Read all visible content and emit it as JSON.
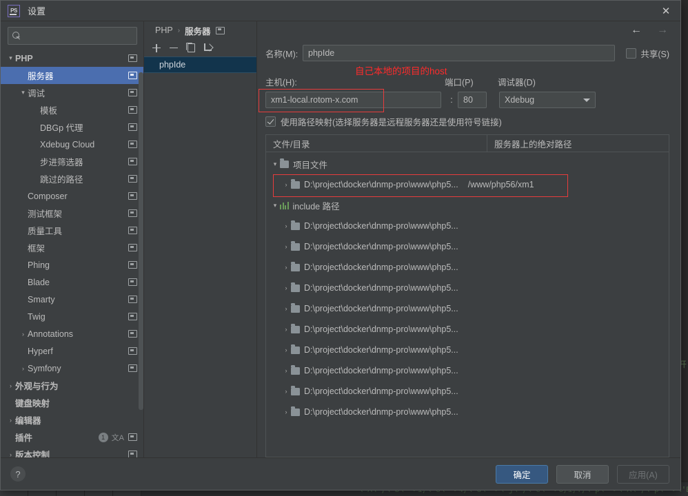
{
  "window": {
    "title": "设置",
    "app_badge": "PS",
    "close_icon": "✕"
  },
  "search": {
    "value": "",
    "placeholder": ""
  },
  "sidebar": {
    "items": [
      {
        "label": "PHP",
        "indent": 0,
        "twisty": "▾",
        "bold": true,
        "selected": false,
        "copy": true
      },
      {
        "label": "服务器",
        "indent": 1,
        "twisty": "",
        "bold": false,
        "selected": true,
        "copy": true
      },
      {
        "label": "调试",
        "indent": 1,
        "twisty": "▾",
        "bold": false,
        "selected": false,
        "copy": true
      },
      {
        "label": "模板",
        "indent": 2,
        "twisty": "",
        "bold": false,
        "selected": false,
        "copy": true
      },
      {
        "label": "DBGp 代理",
        "indent": 2,
        "twisty": "",
        "bold": false,
        "selected": false,
        "copy": true
      },
      {
        "label": "Xdebug Cloud",
        "indent": 2,
        "twisty": "",
        "bold": false,
        "selected": false,
        "copy": true
      },
      {
        "label": "步进筛选器",
        "indent": 2,
        "twisty": "",
        "bold": false,
        "selected": false,
        "copy": true
      },
      {
        "label": "跳过的路径",
        "indent": 2,
        "twisty": "",
        "bold": false,
        "selected": false,
        "copy": true
      },
      {
        "label": "Composer",
        "indent": 1,
        "twisty": "",
        "bold": false,
        "selected": false,
        "copy": true
      },
      {
        "label": "测试框架",
        "indent": 1,
        "twisty": "",
        "bold": false,
        "selected": false,
        "copy": true
      },
      {
        "label": "质量工具",
        "indent": 1,
        "twisty": "",
        "bold": false,
        "selected": false,
        "copy": true
      },
      {
        "label": "框架",
        "indent": 1,
        "twisty": "",
        "bold": false,
        "selected": false,
        "copy": true
      },
      {
        "label": "Phing",
        "indent": 1,
        "twisty": "",
        "bold": false,
        "selected": false,
        "copy": true
      },
      {
        "label": "Blade",
        "indent": 1,
        "twisty": "",
        "bold": false,
        "selected": false,
        "copy": true
      },
      {
        "label": "Smarty",
        "indent": 1,
        "twisty": "",
        "bold": false,
        "selected": false,
        "copy": true
      },
      {
        "label": "Twig",
        "indent": 1,
        "twisty": "",
        "bold": false,
        "selected": false,
        "copy": true
      },
      {
        "label": "Annotations",
        "indent": 1,
        "twisty": "›",
        "bold": false,
        "selected": false,
        "copy": true
      },
      {
        "label": "Hyperf",
        "indent": 1,
        "twisty": "",
        "bold": false,
        "selected": false,
        "copy": true
      },
      {
        "label": "Symfony",
        "indent": 1,
        "twisty": "›",
        "bold": false,
        "selected": false,
        "copy": true
      },
      {
        "label": "外观与行为",
        "indent": 0,
        "twisty": "›",
        "bold": true,
        "selected": false,
        "copy": false
      },
      {
        "label": "键盘映射",
        "indent": 0,
        "twisty": "",
        "bold": true,
        "selected": false,
        "copy": false
      },
      {
        "label": "编辑器",
        "indent": 0,
        "twisty": "›",
        "bold": true,
        "selected": false,
        "copy": false
      },
      {
        "label": "插件",
        "indent": 0,
        "twisty": "",
        "bold": true,
        "selected": false,
        "copy": true,
        "badge": "1",
        "translate": "文A"
      },
      {
        "label": "版本控制",
        "indent": 0,
        "twisty": "›",
        "bold": true,
        "selected": false,
        "copy": true
      }
    ]
  },
  "breadcrumb": {
    "root": "PHP",
    "separator": "›",
    "current": "服务器"
  },
  "list_toolbar": {
    "add": "add-icon",
    "remove": "remove-icon",
    "copy": "copy-icon",
    "import": "import-icon"
  },
  "server_list": {
    "items": [
      {
        "name": "phpIde",
        "selected": true
      }
    ]
  },
  "nav": {
    "back": "←",
    "forward": "→"
  },
  "form": {
    "name_label": "名称(M):",
    "name_mnemonic": "M",
    "name_value": "phpIde",
    "share_label": "共享(S)",
    "share_checked": false,
    "host_label": "主机(H):",
    "host_value": "xm1-local.rotom-x.com",
    "colon": ":",
    "port_label": "端口(P)",
    "port_value": "80",
    "debugger_label": "调试器(D)",
    "debugger_value": "Xdebug",
    "usemap_label": "使用路径映射(选择服务器是远程服务器还是使用符号链接)",
    "usemap_checked": true,
    "annotation": "自己本地的项目的host",
    "annotation_color": "#ff2b2b"
  },
  "mapping_table": {
    "col1": "文件/目录",
    "col2": "服务器上的绝对路径",
    "groups": [
      {
        "twisty": "▾",
        "icon": "folder-icon",
        "label": "项目文件",
        "rows": [
          {
            "twisty": "›",
            "icon": "folder-icon",
            "local": "D:\\project\\docker\\dnmp-pro\\www\\php5...",
            "remote": "/www/php56/xm1",
            "highlighted": true
          }
        ]
      },
      {
        "twisty": "▾",
        "icon": "include-bars-icon",
        "label": "include 路径",
        "rows": [
          {
            "twisty": "›",
            "icon": "folder-icon",
            "local": "D:\\project\\docker\\dnmp-pro\\www\\php5...",
            "remote": "",
            "highlighted": false
          },
          {
            "twisty": "›",
            "icon": "folder-icon",
            "local": "D:\\project\\docker\\dnmp-pro\\www\\php5...",
            "remote": "",
            "highlighted": false
          },
          {
            "twisty": "›",
            "icon": "folder-icon",
            "local": "D:\\project\\docker\\dnmp-pro\\www\\php5...",
            "remote": "",
            "highlighted": false
          },
          {
            "twisty": "›",
            "icon": "folder-icon",
            "local": "D:\\project\\docker\\dnmp-pro\\www\\php5...",
            "remote": "",
            "highlighted": false
          },
          {
            "twisty": "›",
            "icon": "folder-icon",
            "local": "D:\\project\\docker\\dnmp-pro\\www\\php5...",
            "remote": "",
            "highlighted": false
          },
          {
            "twisty": "›",
            "icon": "folder-icon",
            "local": "D:\\project\\docker\\dnmp-pro\\www\\php5...",
            "remote": "",
            "highlighted": false
          },
          {
            "twisty": "›",
            "icon": "folder-icon",
            "local": "D:\\project\\docker\\dnmp-pro\\www\\php5...",
            "remote": "",
            "highlighted": false
          },
          {
            "twisty": "›",
            "icon": "folder-icon",
            "local": "D:\\project\\docker\\dnmp-pro\\www\\php5...",
            "remote": "",
            "highlighted": false
          },
          {
            "twisty": "›",
            "icon": "folder-icon",
            "local": "D:\\project\\docker\\dnmp-pro\\www\\php5...",
            "remote": "",
            "highlighted": false
          },
          {
            "twisty": "›",
            "icon": "folder-icon",
            "local": "D:\\project\\docker\\dnmp-pro\\www\\php5...",
            "remote": "",
            "highlighted": false
          }
        ]
      }
    ]
  },
  "footer": {
    "help": "?",
    "ok": "确定",
    "cancel": "取消",
    "apply": "应用(A)"
  }
}
